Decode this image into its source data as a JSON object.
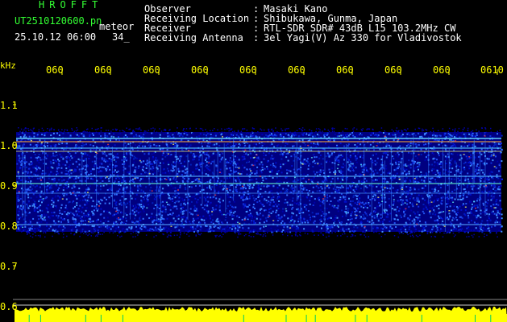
{
  "header": {
    "brand": "HROFFT",
    "filename": "UT2510120600.pn",
    "mode": "meteor",
    "datetime": "25.10.12 06:00",
    "number": "34_"
  },
  "info": [
    {
      "label": "Observer",
      "value": "Masaki Kano"
    },
    {
      "label": "Receiving Location",
      "value": "Shibukawa, Gunma, Japan"
    },
    {
      "label": "Receiver",
      "value": "RTL-SDR SDR# 43dB L15 103.2MHz CW"
    },
    {
      "label": "Receiving Antenna",
      "value": "3el Yagi(V) Az 330 for Vladivostok"
    }
  ],
  "info_separator": ":",
  "axis": {
    "unit": "kHz",
    "time_labels": [
      "060",
      "060",
      "060",
      "060",
      "060",
      "060",
      "060",
      "060",
      "060",
      "0610"
    ],
    "freq_labels": [
      "1.1",
      "1.0",
      "0.9",
      "0.8",
      "0.7",
      "0.6"
    ]
  },
  "colors": {
    "brand": "#33ff33",
    "text": "#ffffff",
    "axis": "#ffff00",
    "noise_dark": "#000080",
    "noise_light": "#3399ff",
    "signal": "#ffff00"
  }
}
